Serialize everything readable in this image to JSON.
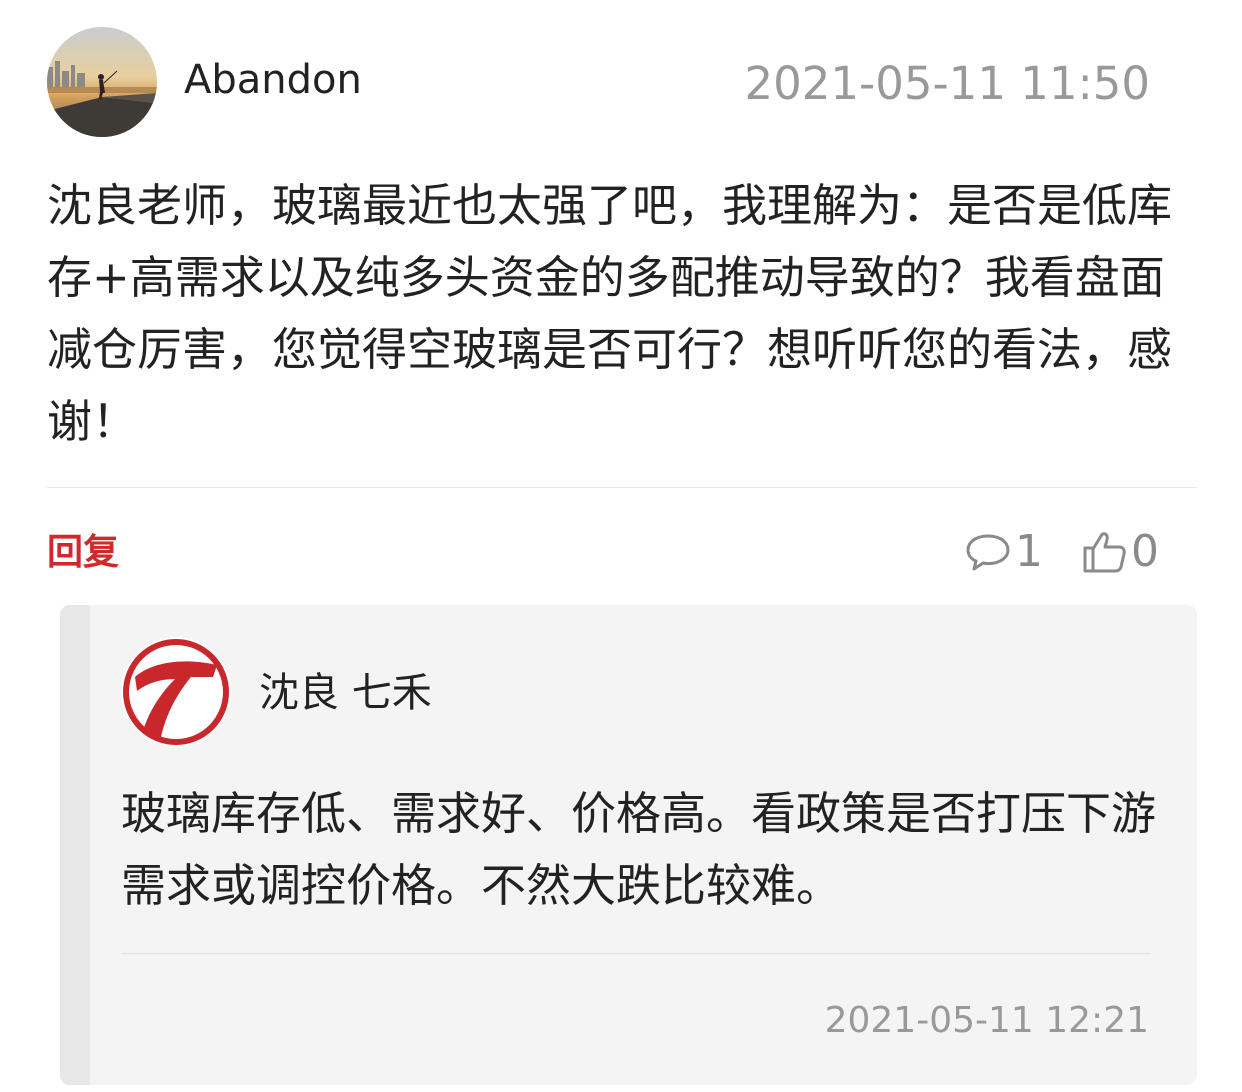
{
  "post": {
    "author": "Abandon",
    "avatar_icon": "sunset-fisherman-avatar",
    "timestamp": "2021-05-11 11:50",
    "content": "沈良老师，玻璃最近也太强了吧，我理解为：是否是低库存+高需求以及纯多头资金的多配推动导致的？我看盘面减仓厉害，您觉得空玻璃是否可行？想听听您的看法，感谢！"
  },
  "actions": {
    "reply_label": "回复",
    "comment_icon": "comment-bubble-icon",
    "comment_count": "1",
    "like_icon": "thumbs-up-icon",
    "like_count": "0"
  },
  "reply": {
    "author": "沈良 七禾",
    "avatar_icon": "qihe-seven-logo",
    "content": "玻璃库存低、需求好、价格高。看政策是否打压下游需求或调控价格。不然大跌比较难。",
    "timestamp": "2021-05-11 12:21"
  },
  "colors": {
    "accent_red": "#d0292b",
    "muted_gray": "#999999",
    "text": "#222222",
    "reply_bg": "#f4f4f4"
  }
}
